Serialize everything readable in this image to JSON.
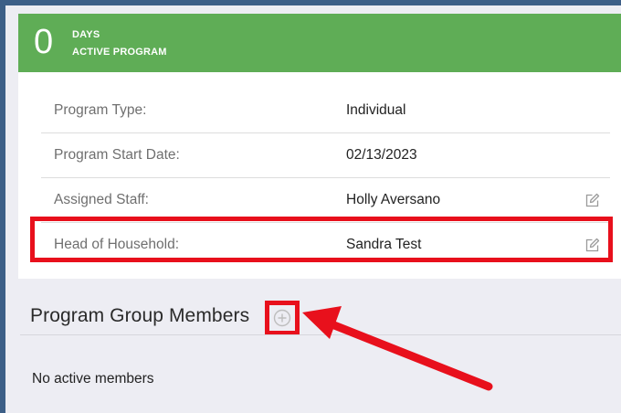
{
  "program": {
    "day_count": "0",
    "day_unit": "DAYS",
    "status": "ACTIVE PROGRAM",
    "banner_color": "#5fad56"
  },
  "details": [
    {
      "label": "Program Type:",
      "value": "Individual",
      "editable": false
    },
    {
      "label": "Program Start Date:",
      "value": "02/13/2023",
      "editable": false
    },
    {
      "label": "Assigned Staff:",
      "value": "Holly Aversano",
      "editable": true,
      "icon": "edit-icon"
    },
    {
      "label": "Head of Household:",
      "value": "Sandra Test",
      "editable": true,
      "icon": "edit-icon"
    }
  ],
  "group_members": {
    "title": "Program Group Members",
    "add_icon": "plus-circle-icon",
    "empty_text": "No active members"
  },
  "annotations": {
    "highlight_color": "#e8101c"
  }
}
